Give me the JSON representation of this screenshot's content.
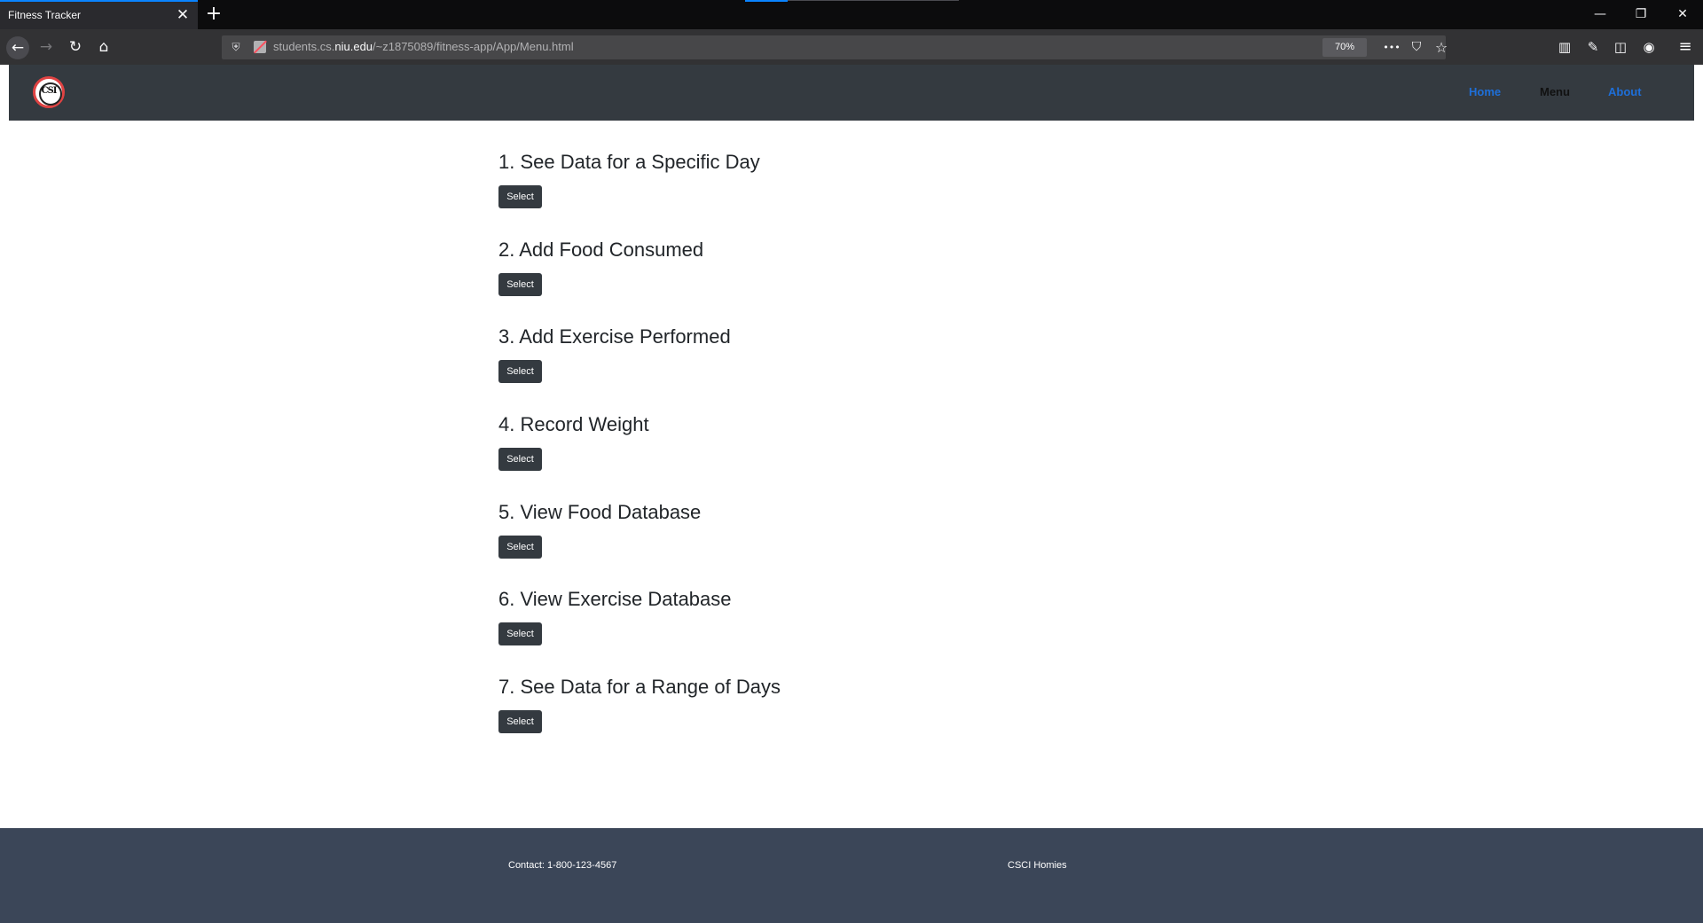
{
  "browser": {
    "tab_title": "Fitness Tracker",
    "tab_close_glyph": "✕",
    "new_tab_glyph": "+",
    "url_prefix": "students.cs.",
    "url_host": "niu.edu",
    "url_path": "/~z1875089/fitness-app/App/Menu.html",
    "zoom": "70%",
    "window_controls": {
      "minimize": "—",
      "restore": "❐",
      "close": "✕"
    },
    "nav": {
      "back": "←",
      "forward": "→",
      "reload": "↻",
      "home": "⌂"
    },
    "url_actions": {
      "more": "•••",
      "pocket": "⛉",
      "bookmark": "☆"
    },
    "toolbar": {
      "library": "▥",
      "tools": "✎",
      "sidebar": "◫",
      "account": "◉",
      "menu": "≡"
    },
    "icons": [
      "back-icon",
      "forward-icon",
      "reload-icon",
      "home-icon",
      "shield-icon",
      "lock-icon",
      "more-icon",
      "pocket-icon",
      "bookmark-star-icon",
      "library-icon",
      "wrench-icon",
      "sidebar-icon",
      "account-icon",
      "hamburger-menu-icon"
    ]
  },
  "site": {
    "nav": {
      "home": "Home",
      "menu": "Menu",
      "about": "About"
    },
    "logo_text": "CSI"
  },
  "menu": {
    "items": [
      {
        "title": "1. See Data for a Specific Day",
        "button": "Select"
      },
      {
        "title": "2. Add Food Consumed",
        "button": "Select"
      },
      {
        "title": "3. Add Exercise Performed",
        "button": "Select"
      },
      {
        "title": "4. Record Weight",
        "button": "Select"
      },
      {
        "title": "5. View Food Database",
        "button": "Select"
      },
      {
        "title": "6. View Exercise Database",
        "button": "Select"
      },
      {
        "title": "7. See Data for a Range of Days",
        "button": "Select"
      }
    ]
  },
  "footer": {
    "contact": "Contact: 1-800-123-4567",
    "team": "CSCI Homies"
  },
  "colors": {
    "header_bg": "#343a40",
    "footer_bg": "#3b4658",
    "nav_link": "#1e6fd9",
    "button_bg": "#343a40"
  }
}
